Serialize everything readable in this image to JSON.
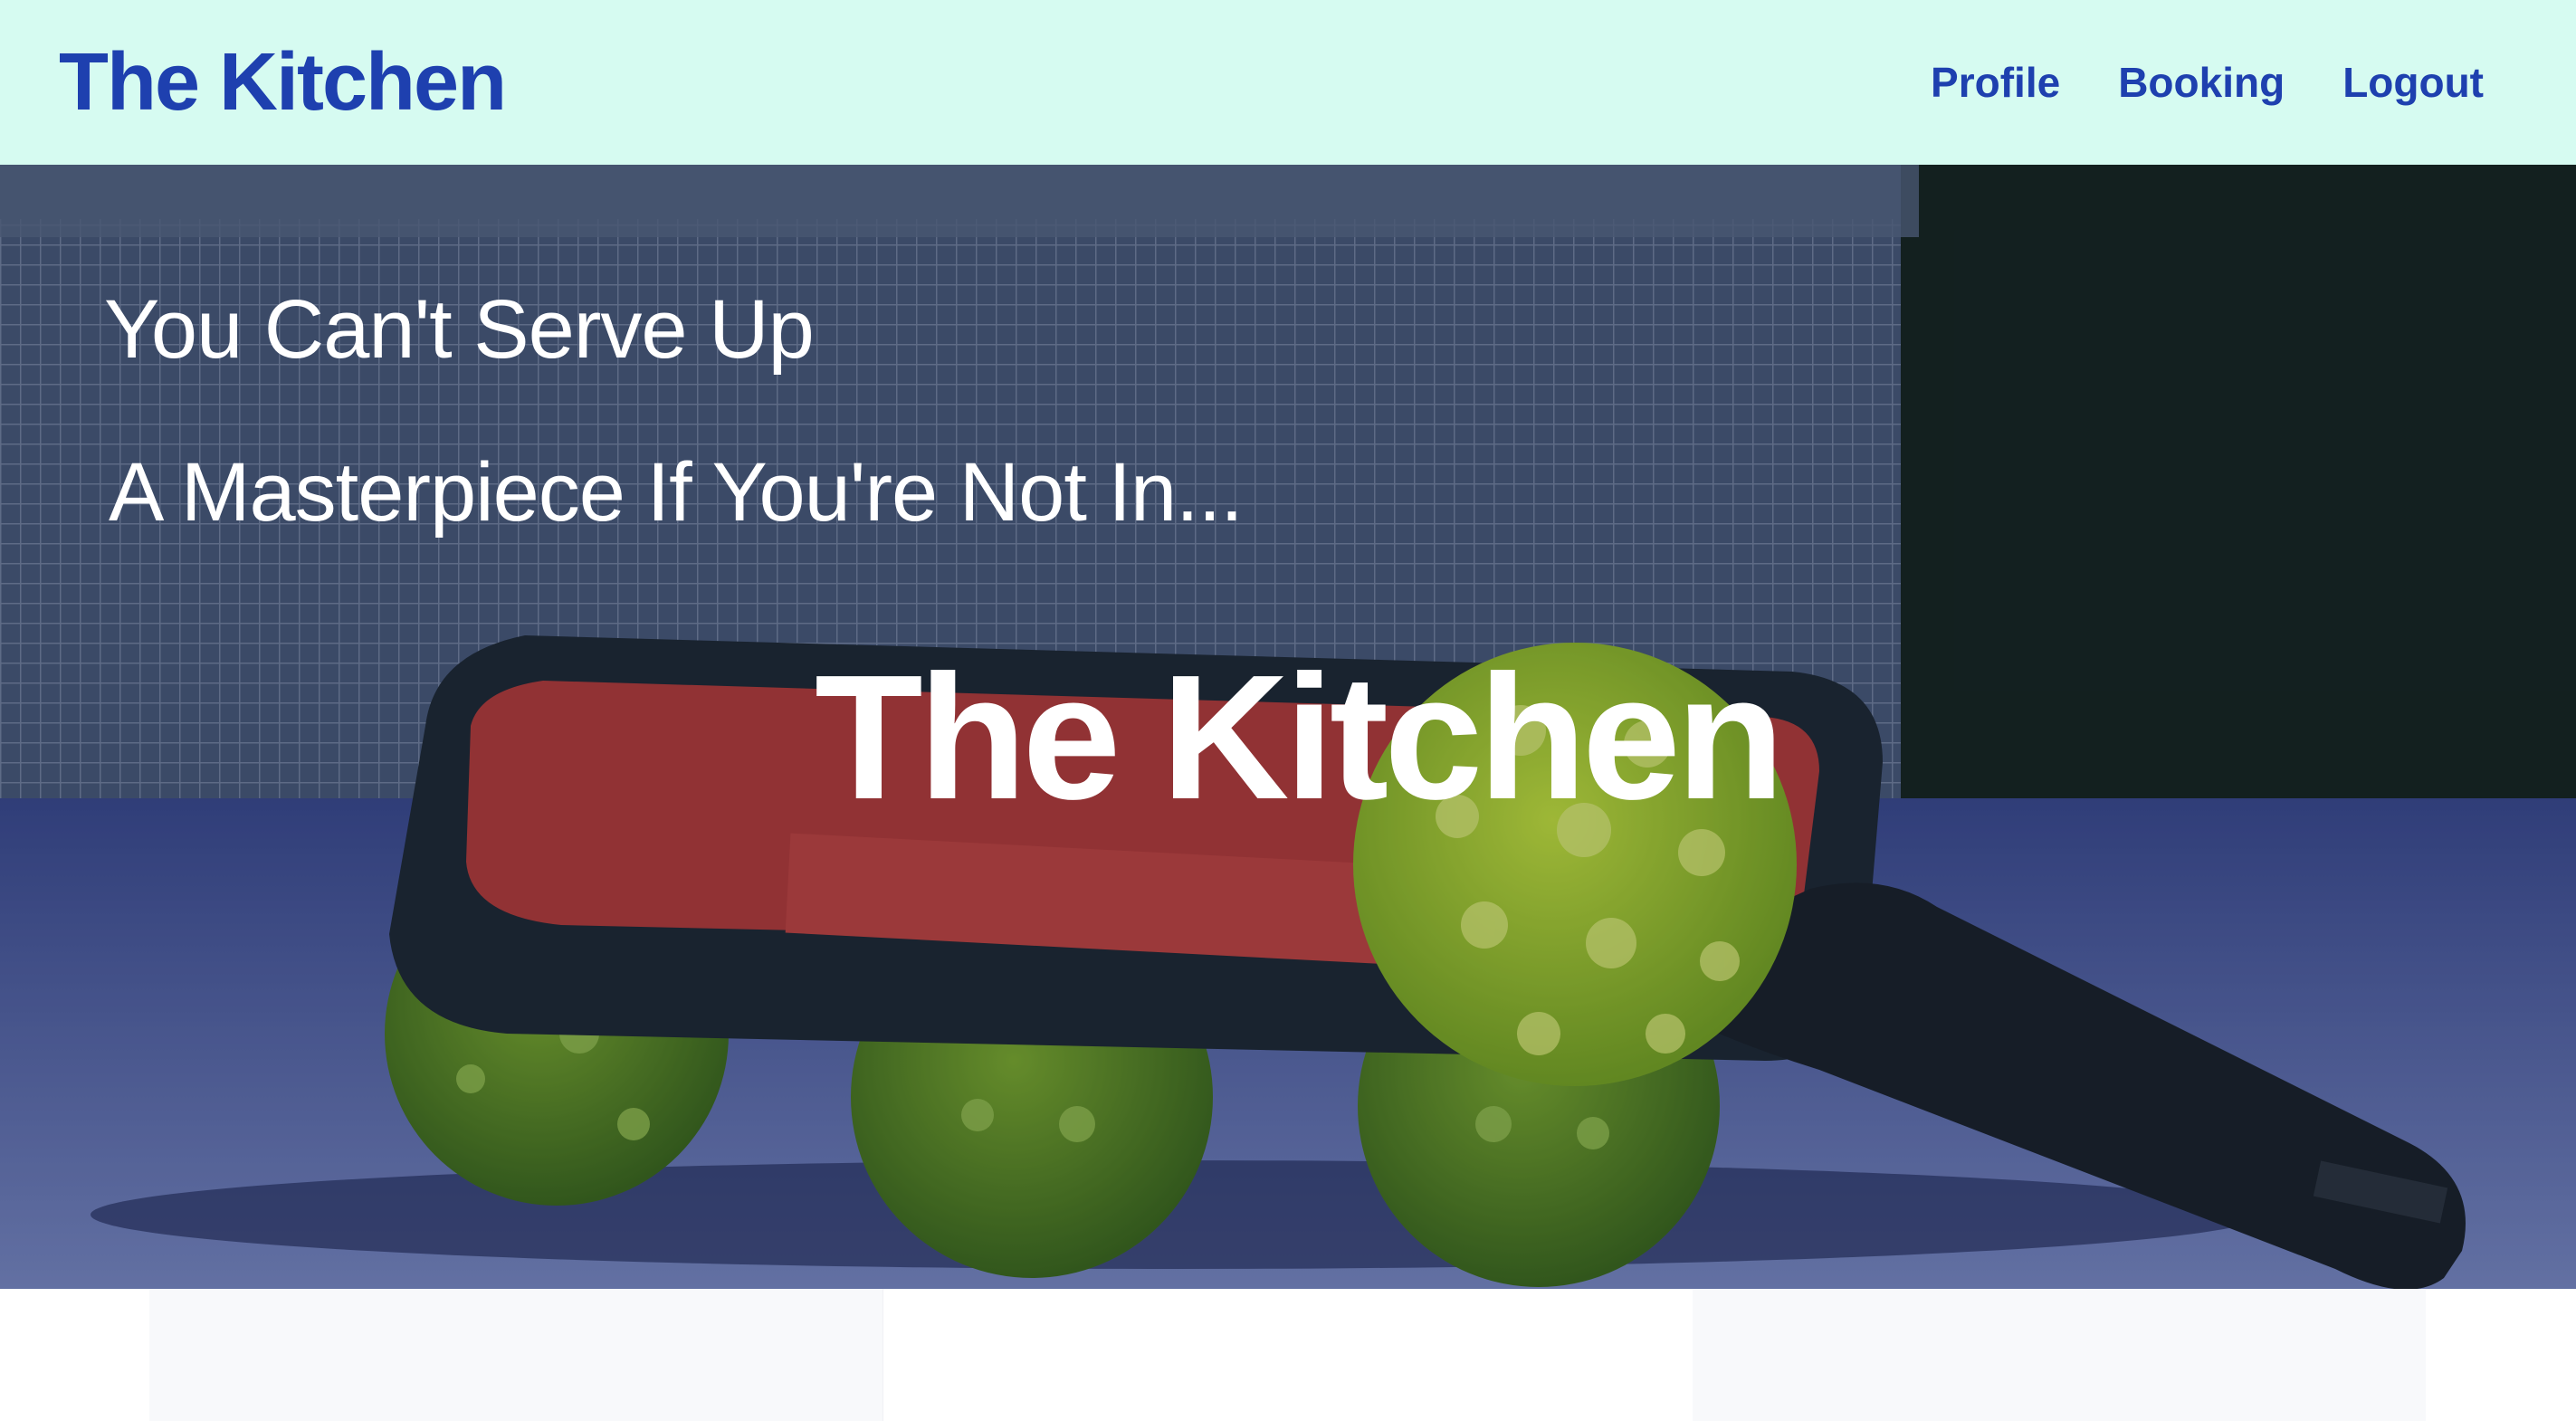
{
  "navbar": {
    "brand": "The Kitchen",
    "links": [
      "Profile",
      "Booking",
      "Logout"
    ]
  },
  "hero": {
    "tagline_line1": "You Can't Serve Up",
    "tagline_line2": "A Masterpiece If You're Not In...",
    "title": "The Kitchen"
  },
  "colors": {
    "navbar_bg": "#d6fbf1",
    "brand_blue": "#1e40af",
    "hero_text": "#ffffff"
  }
}
